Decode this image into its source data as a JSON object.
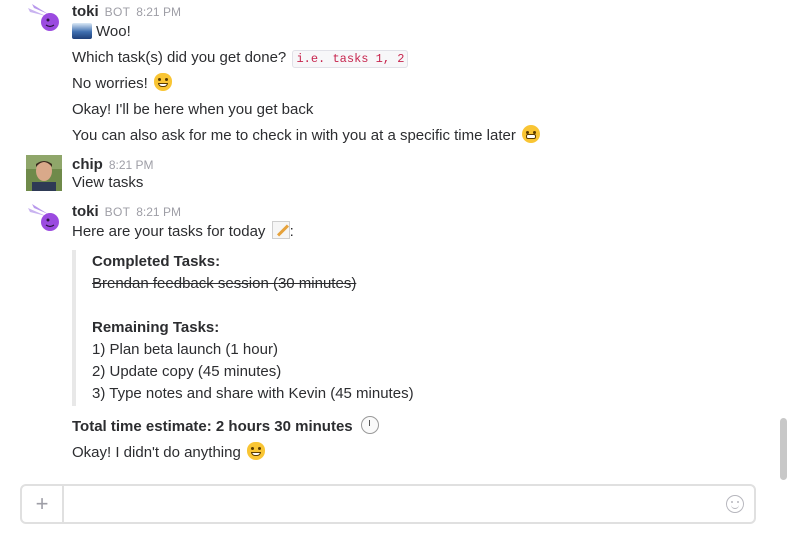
{
  "messages": [
    {
      "sender": "toki",
      "bot_tag": "BOT",
      "time": "8:21 PM",
      "lines": {
        "woo": "Woo!",
        "which_prefix": "Which task(s) did you get done?",
        "which_code": "i.e. tasks 1, 2",
        "no_worries": "No worries!",
        "okay_back": "Okay! I'll be here when you get back",
        "also_ask": "You can also ask for me to check in with you at a specific time later"
      }
    },
    {
      "sender": "chip",
      "time": "8:21 PM",
      "lines": {
        "view_tasks": "View tasks"
      }
    },
    {
      "sender": "toki",
      "bot_tag": "BOT",
      "time": "8:21 PM",
      "lines": {
        "intro": "Here are your tasks for today",
        "intro_suffix": ":",
        "total": "Total time estimate: 2 hours 30 minutes",
        "didnt": "Okay! I didn't do anything"
      },
      "attachment": {
        "completed_title": "Completed Tasks:",
        "completed": [
          "Brendan feedback session (30 minutes)"
        ],
        "remaining_title": "Remaining Tasks:",
        "remaining": [
          "1) Plan beta launch (1 hour)",
          "2) Update copy (45 minutes)",
          "3) Type notes and share with Kevin (45 minutes)"
        ]
      }
    }
  ],
  "composer": {
    "plus_label": "+",
    "placeholder": ""
  },
  "icons": {
    "toki_avatar": "toki-bot-avatar",
    "chip_avatar": "user-photo-avatar",
    "wave": "wave-emoji",
    "smile_cat": "smiley-cat-emoji",
    "grin": "grin-emoji",
    "memo": "memo-emoji",
    "clock": "clock-emoji",
    "emoji_picker": "smiley-icon"
  },
  "colors": {
    "code_text": "#c7254e",
    "bot_purple": "#9b4be0",
    "attachment_border": "#e8e8e8"
  }
}
